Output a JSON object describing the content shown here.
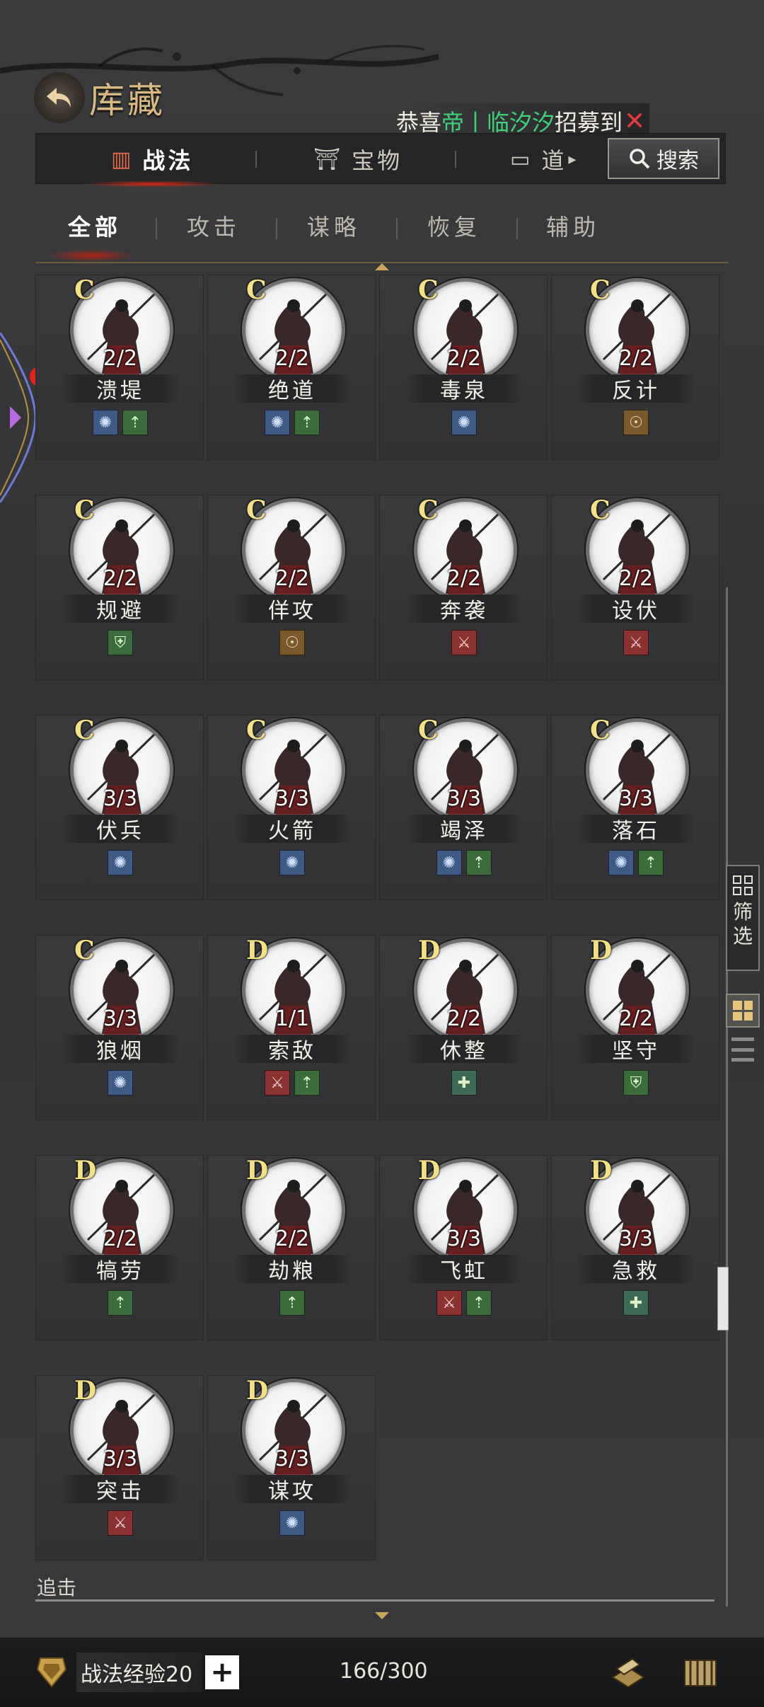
{
  "header": {
    "title": "库藏",
    "notice": {
      "prefix": "恭喜",
      "name": "帝丨临汐汐",
      "suffix": "招募到"
    }
  },
  "main_tabs": [
    {
      "label": "战法",
      "icon": "scroll-icon",
      "active": true
    },
    {
      "label": "宝物",
      "icon": "treasure-icon",
      "active": false
    },
    {
      "label": "道具",
      "icon": "item-icon",
      "active": false
    }
  ],
  "main_tabs_display": {
    "third": "道"
  },
  "search": {
    "label": "搜索"
  },
  "sub_tabs": [
    {
      "label": "全部",
      "active": true
    },
    {
      "label": "攻击",
      "active": false
    },
    {
      "label": "谋略",
      "active": false
    },
    {
      "label": "恢复",
      "active": false
    },
    {
      "label": "辅助",
      "active": false
    }
  ],
  "tactics": [
    {
      "grade": "C",
      "count": "2/2",
      "name": "溃堤",
      "types": [
        "strategy",
        "buff"
      ]
    },
    {
      "grade": "C",
      "count": "2/2",
      "name": "绝道",
      "types": [
        "strategy",
        "buff"
      ]
    },
    {
      "grade": "C",
      "count": "2/2",
      "name": "毒泉",
      "types": [
        "strategy"
      ]
    },
    {
      "grade": "C",
      "count": "2/2",
      "name": "反计",
      "types": [
        "control"
      ]
    },
    {
      "grade": "C",
      "count": "2/2",
      "name": "规避",
      "types": [
        "defense"
      ]
    },
    {
      "grade": "C",
      "count": "2/2",
      "name": "佯攻",
      "types": [
        "control"
      ]
    },
    {
      "grade": "C",
      "count": "2/2",
      "name": "奔袭",
      "types": [
        "attack"
      ]
    },
    {
      "grade": "C",
      "count": "2/2",
      "name": "设伏",
      "types": [
        "attack"
      ]
    },
    {
      "grade": "C",
      "count": "3/3",
      "name": "伏兵",
      "types": [
        "strategy"
      ]
    },
    {
      "grade": "C",
      "count": "3/3",
      "name": "火箭",
      "types": [
        "strategy"
      ]
    },
    {
      "grade": "C",
      "count": "3/3",
      "name": "竭泽",
      "types": [
        "strategy",
        "buff"
      ]
    },
    {
      "grade": "C",
      "count": "3/3",
      "name": "落石",
      "types": [
        "strategy",
        "buff"
      ]
    },
    {
      "grade": "C",
      "count": "3/3",
      "name": "狼烟",
      "types": [
        "strategy"
      ]
    },
    {
      "grade": "D",
      "count": "1/1",
      "name": "索敌",
      "types": [
        "attack",
        "buff"
      ]
    },
    {
      "grade": "D",
      "count": "2/2",
      "name": "休整",
      "types": [
        "heal"
      ]
    },
    {
      "grade": "D",
      "count": "2/2",
      "name": "坚守",
      "types": [
        "defense"
      ]
    },
    {
      "grade": "D",
      "count": "2/2",
      "name": "犒劳",
      "types": [
        "buff"
      ]
    },
    {
      "grade": "D",
      "count": "2/2",
      "name": "劫粮",
      "types": [
        "buff"
      ]
    },
    {
      "grade": "D",
      "count": "3/3",
      "name": "飞虹",
      "types": [
        "attack",
        "buff"
      ]
    },
    {
      "grade": "D",
      "count": "3/3",
      "name": "急救",
      "types": [
        "heal"
      ]
    },
    {
      "grade": "D",
      "count": "3/3",
      "name": "突击",
      "types": [
        "attack"
      ]
    },
    {
      "grade": "D",
      "count": "3/3",
      "name": "谋攻",
      "types": [
        "strategy"
      ]
    }
  ],
  "caption": "追击",
  "side": {
    "filter_label_1": "筛",
    "filter_label_2": "选"
  },
  "footer": {
    "exp_label": "战法经验20",
    "plus": "+",
    "capacity": "166/300"
  },
  "colors": {
    "accent_gold": "#d9b982",
    "notice_green": "#3fd17a",
    "grade_yellow": "#f5e08a"
  }
}
